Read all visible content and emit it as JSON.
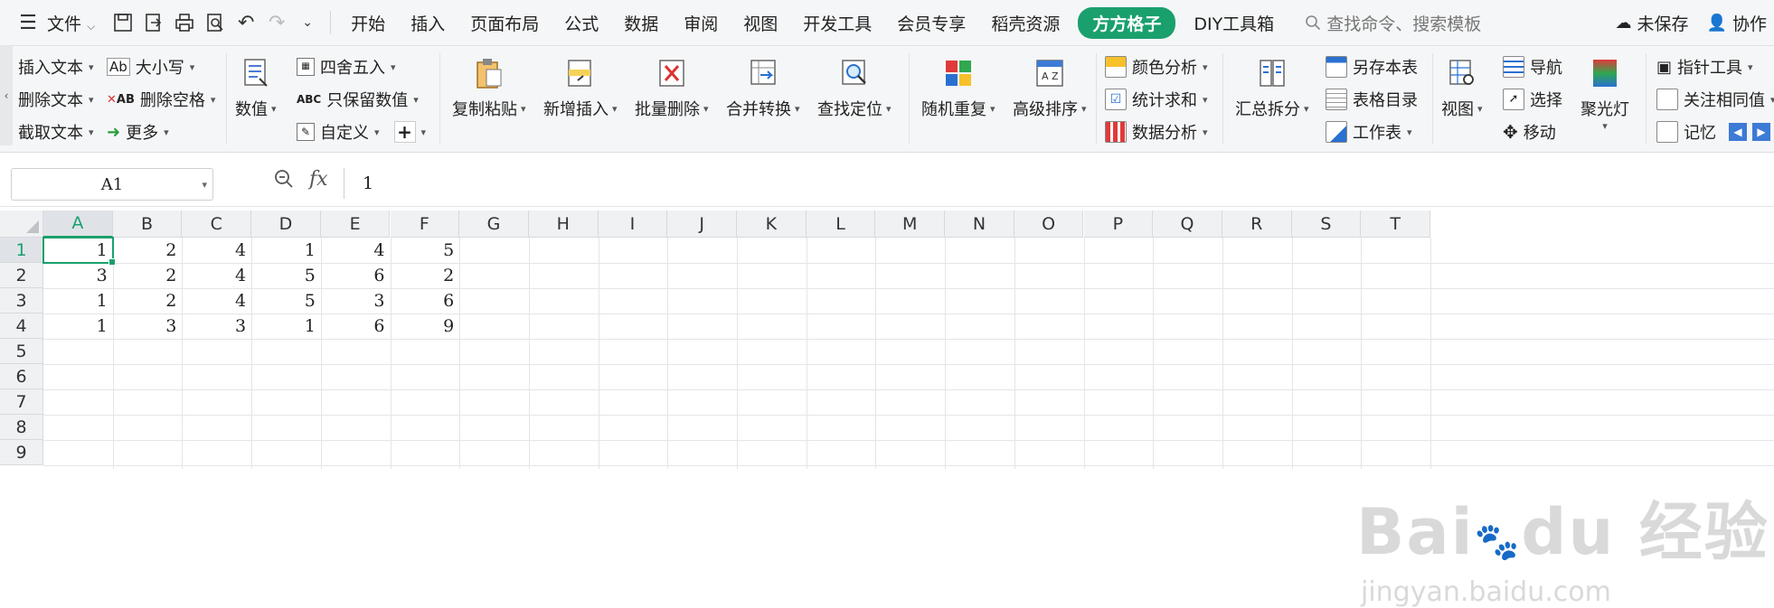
{
  "menubar": {
    "file_label": "文件",
    "tabs": [
      "开始",
      "插入",
      "页面布局",
      "公式",
      "数据",
      "审阅",
      "视图",
      "开发工具",
      "会员专享",
      "稻壳资源",
      "方方格子",
      "DIY工具箱"
    ],
    "active_tab": "方方格子",
    "search_placeholder": "查找命令、搜索模板",
    "unsaved_label": "未保存",
    "collab_label": "协作",
    "accent_color": "#1aa06d"
  },
  "ribbon": {
    "text_group": [
      "插入文本",
      "删除文本",
      "截取文本"
    ],
    "case_group": [
      "大小写",
      "删除空格",
      "更多"
    ],
    "value_label": "数值",
    "round_group": [
      "四舍五入",
      "只保留数值",
      "自定义"
    ],
    "clip_group": [
      "复制粘贴",
      "新增插入",
      "批量删除",
      "合并转换",
      "查找定位"
    ],
    "sort_group": [
      "随机重复",
      "高级排序"
    ],
    "analysis_group": [
      "颜色分析",
      "统计求和",
      "数据分析"
    ],
    "summary_label": "汇总拆分",
    "sheet_group": [
      "另存本表",
      "表格目录",
      "工作表"
    ],
    "view_label": "视图",
    "nav_group": [
      "导航",
      "选择",
      "移动"
    ],
    "spotlight_label": "聚光灯",
    "tool_group": [
      "指针工具",
      "关注相同值",
      "记忆"
    ]
  },
  "formula_bar": {
    "name_box": "A1",
    "fx_label": "fx",
    "formula": "1"
  },
  "sheet": {
    "columns": [
      "A",
      "B",
      "C",
      "D",
      "E",
      "F",
      "G",
      "H",
      "I",
      "J",
      "K",
      "L",
      "M",
      "N",
      "O",
      "P",
      "Q",
      "R",
      "S",
      "T"
    ],
    "rows": [
      "1",
      "2",
      "3",
      "4",
      "5",
      "6",
      "7",
      "8",
      "9"
    ],
    "data": [
      [
        "1",
        "2",
        "4",
        "1",
        "4",
        "5"
      ],
      [
        "3",
        "2",
        "4",
        "5",
        "6",
        "2"
      ],
      [
        "1",
        "2",
        "4",
        "5",
        "3",
        "6"
      ],
      [
        "1",
        "3",
        "3",
        "1",
        "6",
        "9"
      ]
    ],
    "active_cell": "A1"
  },
  "watermark": {
    "logo_text": "Bai du 经验",
    "url_text": "jingyan.baidu.com"
  }
}
